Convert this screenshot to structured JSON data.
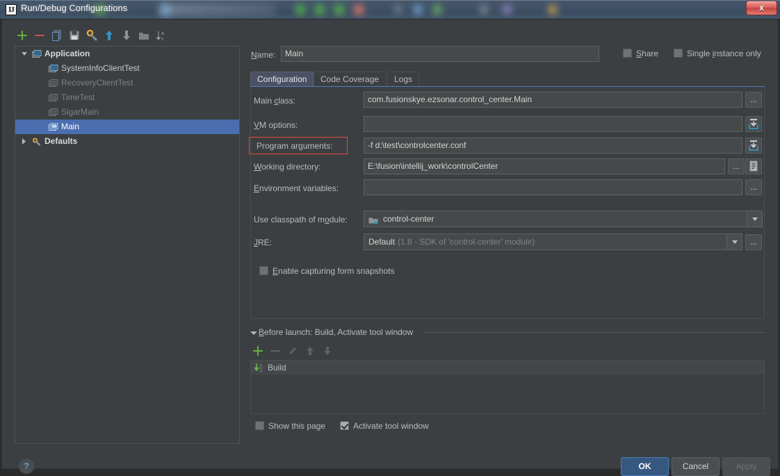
{
  "window": {
    "title": "Run/Debug Configurations",
    "app_icon": "intellij-idea-icon",
    "close_label": "x"
  },
  "toolbar": {
    "buttons": [
      {
        "name": "add-configuration-button",
        "icon": "plus-icon"
      },
      {
        "name": "remove-configuration-button",
        "icon": "minus-icon"
      },
      {
        "name": "copy-configuration-button",
        "icon": "copy-icon"
      },
      {
        "name": "save-configuration-button",
        "icon": "save-icon"
      },
      {
        "name": "edit-defaults-button",
        "icon": "wrench-icon"
      },
      {
        "name": "move-up-button",
        "icon": "arrow-up-icon"
      },
      {
        "name": "move-down-button",
        "icon": "arrow-down-icon"
      },
      {
        "name": "create-folder-button",
        "icon": "folder-icon"
      },
      {
        "name": "sort-configurations-button",
        "icon": "sort-az-icon"
      }
    ]
  },
  "tree": {
    "nodes": [
      {
        "label": "Application",
        "style": "bold",
        "indent": 0,
        "twisty": "expanded",
        "icon": "application-icon"
      },
      {
        "label": "SystemInfoClientTest",
        "style": "normal",
        "indent": 1,
        "twisty": "none",
        "icon": "application-icon"
      },
      {
        "label": "RecoveryClientTest",
        "style": "dim",
        "indent": 1,
        "twisty": "none",
        "icon": "application-icon-dim"
      },
      {
        "label": "TimeTest",
        "style": "dim",
        "indent": 1,
        "twisty": "none",
        "icon": "application-icon-dim"
      },
      {
        "label": "SigarMain",
        "style": "dim",
        "indent": 1,
        "twisty": "none",
        "icon": "application-icon-dim"
      },
      {
        "label": "Main",
        "style": "selected",
        "indent": 1,
        "twisty": "none",
        "icon": "application-icon"
      },
      {
        "label": "Defaults",
        "style": "bold",
        "indent": 0,
        "twisty": "collapsed",
        "icon": "wrench-icon"
      }
    ]
  },
  "header": {
    "name_label": "Name:",
    "name_value": "Main",
    "share_label": "Share",
    "share_checked": false,
    "single_instance_label": "Single instance only",
    "single_instance_checked": false
  },
  "tabs": [
    {
      "label": "Configuration",
      "active": true
    },
    {
      "label": "Code Coverage",
      "active": false
    },
    {
      "label": "Logs",
      "active": false
    }
  ],
  "form": {
    "main_class": {
      "label": "Main class:",
      "value": "com.fusionskye.ezsonar.control_center.Main",
      "button": "..."
    },
    "vm_options": {
      "label": "VM options:",
      "value": "",
      "button_icon": "expand-editor-icon"
    },
    "program_arguments": {
      "label": "Program arguments:",
      "value": "-f d:\\test\\controlcenter.conf",
      "button_icon": "expand-editor-icon",
      "highlighted": true,
      "highlight_color": "#e04a3f"
    },
    "working_directory": {
      "label": "Working directory:",
      "value": "E:\\fusion\\intellij_work\\controlCenter",
      "button": "...",
      "button2_icon": "macro-list-icon"
    },
    "environment_variables": {
      "label": "Environment variables:",
      "value": "",
      "button": "..."
    },
    "classpath_module": {
      "label": "Use classpath of module:",
      "value": "control-center",
      "icon": "module-icon"
    },
    "jre": {
      "label": "JRE:",
      "value": "Default",
      "value_hint": "(1.8 - SDK of 'control-center' module)",
      "button": "..."
    },
    "form_snapshots": {
      "label": "Enable capturing form snapshots",
      "checked": false
    }
  },
  "before_launch": {
    "title": "Before launch: Build, Activate tool window",
    "toolbar": [
      {
        "name": "add-task-button",
        "icon": "plus-icon",
        "enabled": true
      },
      {
        "name": "remove-task-button",
        "icon": "minus-icon",
        "enabled": false
      },
      {
        "name": "edit-task-button",
        "icon": "pencil-icon",
        "enabled": false
      },
      {
        "name": "move-task-up-button",
        "icon": "arrow-up-icon",
        "enabled": false
      },
      {
        "name": "move-task-down-button",
        "icon": "arrow-down-icon",
        "enabled": false
      }
    ],
    "items": [
      {
        "label": "Build",
        "icon": "build-icon"
      }
    ],
    "show_page_label": "Show this page",
    "show_page_checked": false,
    "activate_window_label": "Activate tool window",
    "activate_window_checked": true
  },
  "footer": {
    "help_label": "?",
    "ok_label": "OK",
    "cancel_label": "Cancel",
    "apply_label": "Apply",
    "apply_enabled": false
  },
  "colors": {
    "dialog_bg": "#3c3f41",
    "field_bg": "#45494a",
    "selection_blue": "#4b6eaf",
    "accent_blue": "#4a7ebb",
    "annotation_red": "#e04a3f",
    "green": "#62b543",
    "red": "#c75450"
  }
}
